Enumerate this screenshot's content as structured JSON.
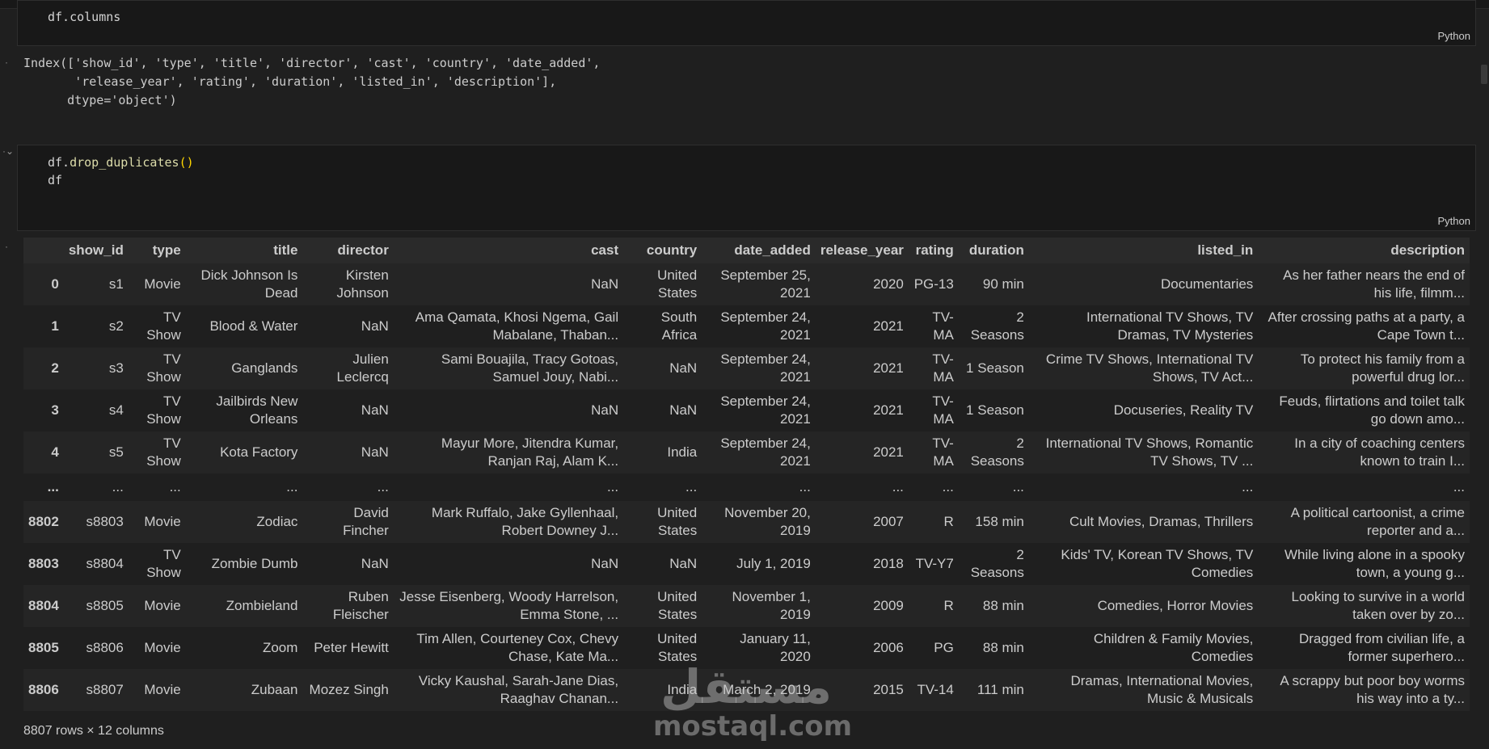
{
  "cell1": {
    "code": "df.columns",
    "lang": "Python"
  },
  "output1": {
    "lines": [
      "Index(['show_id', 'type', 'title', 'director', 'cast', 'country', 'date_added',",
      "       'release_year', 'rating', 'duration', 'listed_in', 'description'],",
      "      dtype='object')"
    ]
  },
  "cell2": {
    "line1_obj": "df.",
    "line1_fn": "drop_duplicates",
    "line1_paren": "()",
    "line2": "df",
    "lang": "Python"
  },
  "table": {
    "headers": [
      "",
      "show_id",
      "type",
      "title",
      "director",
      "cast",
      "country",
      "date_added",
      "release_year",
      "rating",
      "duration",
      "listed_in",
      "description"
    ],
    "rows": [
      [
        "0",
        "s1",
        "Movie",
        "Dick Johnson Is Dead",
        "Kirsten Johnson",
        "NaN",
        "United States",
        "September 25, 2021",
        "2020",
        "PG-13",
        "90 min",
        "Documentaries",
        "As her father nears the end of his life, filmm..."
      ],
      [
        "1",
        "s2",
        "TV Show",
        "Blood & Water",
        "NaN",
        "Ama Qamata, Khosi Ngema, Gail Mabalane, Thaban...",
        "South Africa",
        "September 24, 2021",
        "2021",
        "TV-MA",
        "2 Seasons",
        "International TV Shows, TV Dramas, TV Mysteries",
        "After crossing paths at a party, a Cape Town t..."
      ],
      [
        "2",
        "s3",
        "TV Show",
        "Ganglands",
        "Julien Leclercq",
        "Sami Bouajila, Tracy Gotoas, Samuel Jouy, Nabi...",
        "NaN",
        "September 24, 2021",
        "2021",
        "TV-MA",
        "1 Season",
        "Crime TV Shows, International TV Shows, TV Act...",
        "To protect his family from a powerful drug lor..."
      ],
      [
        "3",
        "s4",
        "TV Show",
        "Jailbirds New Orleans",
        "NaN",
        "NaN",
        "NaN",
        "September 24, 2021",
        "2021",
        "TV-MA",
        "1 Season",
        "Docuseries, Reality TV",
        "Feuds, flirtations and toilet talk go down amo..."
      ],
      [
        "4",
        "s5",
        "TV Show",
        "Kota Factory",
        "NaN",
        "Mayur More, Jitendra Kumar, Ranjan Raj, Alam K...",
        "India",
        "September 24, 2021",
        "2021",
        "TV-MA",
        "2 Seasons",
        "International TV Shows, Romantic TV Shows, TV ...",
        "In a city of coaching centers known to train I..."
      ],
      [
        "...",
        "...",
        "...",
        "...",
        "...",
        "...",
        "...",
        "...",
        "...",
        "...",
        "...",
        "...",
        "..."
      ],
      [
        "8802",
        "s8803",
        "Movie",
        "Zodiac",
        "David Fincher",
        "Mark Ruffalo, Jake Gyllenhaal, Robert Downey J...",
        "United States",
        "November 20, 2019",
        "2007",
        "R",
        "158 min",
        "Cult Movies, Dramas, Thrillers",
        "A political cartoonist, a crime reporter and a..."
      ],
      [
        "8803",
        "s8804",
        "TV Show",
        "Zombie Dumb",
        "NaN",
        "NaN",
        "NaN",
        "July 1, 2019",
        "2018",
        "TV-Y7",
        "2 Seasons",
        "Kids' TV, Korean TV Shows, TV Comedies",
        "While living alone in a spooky town, a young g..."
      ],
      [
        "8804",
        "s8805",
        "Movie",
        "Zombieland",
        "Ruben Fleischer",
        "Jesse Eisenberg, Woody Harrelson, Emma Stone, ...",
        "United States",
        "November 1, 2019",
        "2009",
        "R",
        "88 min",
        "Comedies, Horror Movies",
        "Looking to survive in a world taken over by zo..."
      ],
      [
        "8805",
        "s8806",
        "Movie",
        "Zoom",
        "Peter Hewitt",
        "Tim Allen, Courteney Cox, Chevy Chase, Kate Ma...",
        "United States",
        "January 11, 2020",
        "2006",
        "PG",
        "88 min",
        "Children & Family Movies, Comedies",
        "Dragged from civilian life, a former superhero..."
      ],
      [
        "8806",
        "s8807",
        "Movie",
        "Zubaan",
        "Mozez Singh",
        "Vicky Kaushal, Sarah-Jane Dias, Raaghav Chanan...",
        "India",
        "March 2, 2019",
        "2015",
        "TV-14",
        "111 min",
        "Dramas, International Movies, Music & Musicals",
        "A scrappy but poor boy worms his way into a ty..."
      ]
    ]
  },
  "footer_note": "8807 rows × 12 columns",
  "watermark": {
    "arabic": "مستقل",
    "latin": "mostaql.com"
  }
}
